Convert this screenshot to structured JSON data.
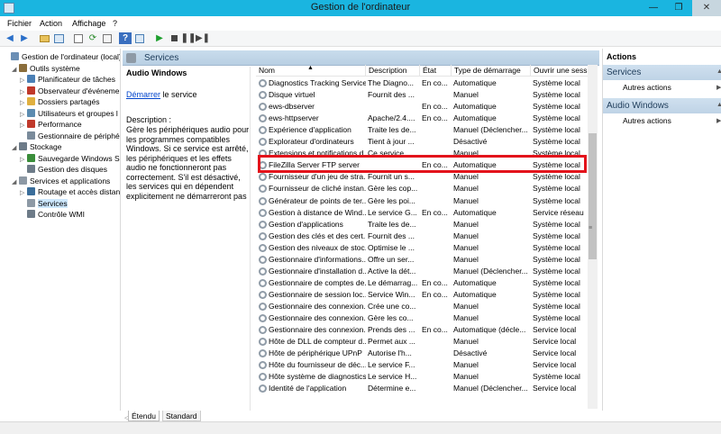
{
  "window": {
    "title": "Gestion de l'ordinateur"
  },
  "menu": [
    "Fichier",
    "Action",
    "Affichage",
    "?"
  ],
  "tree": [
    {
      "label": "Gestion de l'ordinateur (local)",
      "indent": 0,
      "arrow": "",
      "icon_color": "#6c8fb5"
    },
    {
      "label": "Outils système",
      "indent": 1,
      "arrow": "◢",
      "icon_color": "#8a6d3b"
    },
    {
      "label": "Planificateur de tâches",
      "indent": 2,
      "arrow": "▷",
      "icon_color": "#4a7fb5"
    },
    {
      "label": "Observateur d'événeme",
      "indent": 2,
      "arrow": "▷",
      "icon_color": "#c0392b"
    },
    {
      "label": "Dossiers partagés",
      "indent": 2,
      "arrow": "▷",
      "icon_color": "#e0b040"
    },
    {
      "label": "Utilisateurs et groupes l",
      "indent": 2,
      "arrow": "▷",
      "icon_color": "#5b8bb0"
    },
    {
      "label": "Performance",
      "indent": 2,
      "arrow": "▷",
      "icon_color": "#c0392b"
    },
    {
      "label": "Gestionnaire de périphé",
      "indent": 2,
      "arrow": "",
      "icon_color": "#7a8b9b"
    },
    {
      "label": "Stockage",
      "indent": 1,
      "arrow": "◢",
      "icon_color": "#6d7b88"
    },
    {
      "label": "Sauvegarde Windows S",
      "indent": 2,
      "arrow": "▷",
      "icon_color": "#3a8d3a"
    },
    {
      "label": "Gestion des disques",
      "indent": 2,
      "arrow": "",
      "icon_color": "#6d7b88"
    },
    {
      "label": "Services et applications",
      "indent": 1,
      "arrow": "◢",
      "icon_color": "#8d99a5"
    },
    {
      "label": "Routage et accès distan",
      "indent": 2,
      "arrow": "▷",
      "icon_color": "#3a6d9a"
    },
    {
      "label": "Services",
      "indent": 2,
      "arrow": "",
      "icon_color": "#8d99a5",
      "selected": true
    },
    {
      "label": "Contrôle WMI",
      "indent": 2,
      "arrow": "",
      "icon_color": "#6d7b88"
    }
  ],
  "center": {
    "header": "Services",
    "desc_title": "Audio Windows",
    "start_link": "Démarrer",
    "start_suffix": " le service",
    "desc_label": "Description :",
    "desc_text": "Gère les périphériques audio pour les programmes compatibles Windows. Si ce service est arrêté, les périphériques et les effets audio ne fonctionneront pas correctement. S'il est désactivé, les services qui en dépendent explicitement ne démarreront pas"
  },
  "columns": [
    "Nom",
    "Description",
    "État",
    "Type de démarrage",
    "Ouvrir une sessi"
  ],
  "services": [
    [
      "Diagnostics Tracking Service",
      "The Diagno...",
      "En co...",
      "Automatique",
      "Système local"
    ],
    [
      "Disque virtuel",
      "Fournit des ...",
      "",
      "Manuel",
      "Système local"
    ],
    [
      "ews-dbserver",
      "",
      "En co...",
      "Automatique",
      "Système local"
    ],
    [
      "ews-httpserver",
      "Apache/2.4....",
      "En co...",
      "Automatique",
      "Système local"
    ],
    [
      "Expérience d'application",
      "Traite les de...",
      "",
      "Manuel (Déclencher...",
      "Système local"
    ],
    [
      "Explorateur d'ordinateurs",
      "Tient à jour ...",
      "",
      "Désactivé",
      "Système local"
    ],
    [
      "Extensions et notifications d...",
      "Ce service ...",
      "",
      "Manuel",
      "Système local"
    ],
    [
      "FileZilla Server FTP server",
      "",
      "En co...",
      "Automatique",
      "Système local"
    ],
    [
      "Fournisseur d'un jeu de stra...",
      "Fournit un s...",
      "",
      "Manuel",
      "Système local"
    ],
    [
      "Fournisseur de cliché instan...",
      "Gère les cop...",
      "",
      "Manuel",
      "Système local"
    ],
    [
      "Générateur de points de ter...",
      "Gère les poi...",
      "",
      "Manuel",
      "Système local"
    ],
    [
      "Gestion à distance de Wind...",
      "Le service G...",
      "En co...",
      "Automatique",
      "Service réseau"
    ],
    [
      "Gestion d'applications",
      "Traite les de...",
      "",
      "Manuel",
      "Système local"
    ],
    [
      "Gestion des clés et des cert...",
      "Fournit des ...",
      "",
      "Manuel",
      "Système local"
    ],
    [
      "Gestion des niveaux de stoc...",
      "Optimise le ...",
      "",
      "Manuel",
      "Système local"
    ],
    [
      "Gestionnaire d'informations...",
      "Offre un ser...",
      "",
      "Manuel",
      "Système local"
    ],
    [
      "Gestionnaire d'installation d...",
      "Active la dét...",
      "",
      "Manuel (Déclencher...",
      "Système local"
    ],
    [
      "Gestionnaire de comptes de...",
      "Le démarrag...",
      "En co...",
      "Automatique",
      "Système local"
    ],
    [
      "Gestionnaire de session loc...",
      "Service Win...",
      "En co...",
      "Automatique",
      "Système local"
    ],
    [
      "Gestionnaire des connexion...",
      "Crée une co...",
      "",
      "Manuel",
      "Système local"
    ],
    [
      "Gestionnaire des connexion...",
      "Gère les co...",
      "",
      "Manuel",
      "Système local"
    ],
    [
      "Gestionnaire des connexion...",
      "Prends des ...",
      "En co...",
      "Automatique (décle...",
      "Service local"
    ],
    [
      "Hôte de DLL de compteur d...",
      "Permet aux ...",
      "",
      "Manuel",
      "Service local"
    ],
    [
      "Hôte de périphérique UPnP",
      "Autorise l'h...",
      "",
      "Désactivé",
      "Service local"
    ],
    [
      "Hôte du fournisseur de déc...",
      "Le service F...",
      "",
      "Manuel",
      "Service local"
    ],
    [
      "Hôte système de diagnostics",
      "Le service H...",
      "",
      "Manuel",
      "Système local"
    ],
    [
      "Identité de l'application",
      "Détermine e...",
      "",
      "Manuel (Déclencher...",
      "Service local"
    ]
  ],
  "tabs": [
    "Étendu",
    "Standard"
  ],
  "actions": {
    "title": "Actions",
    "groups": [
      {
        "header": "Services",
        "item": "Autres actions"
      },
      {
        "header": "Audio Windows",
        "item": "Autres actions"
      }
    ]
  }
}
